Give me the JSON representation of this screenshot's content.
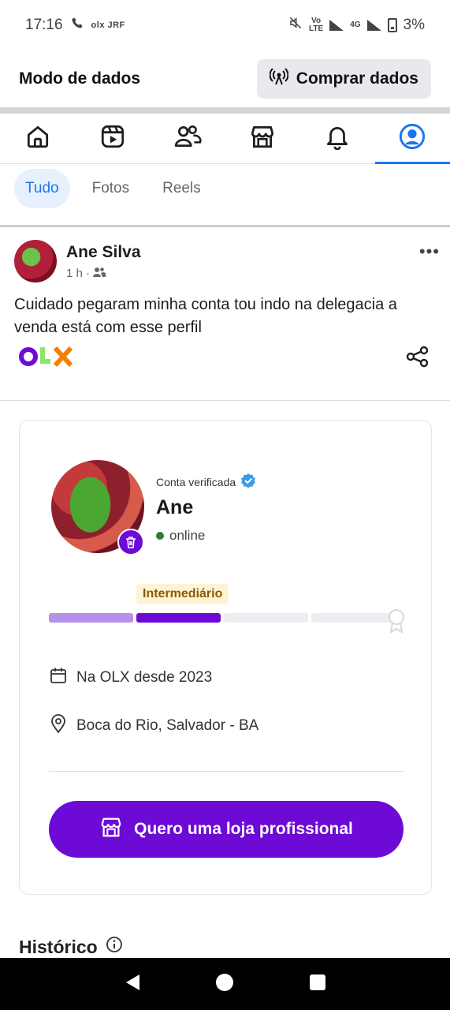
{
  "status_bar": {
    "time": "17:16",
    "carrier_icons_text": "olx JRF",
    "network_volte": "Vo",
    "network_lte": "LTE",
    "network_4g": "4G",
    "battery": "3%"
  },
  "data_bar": {
    "title": "Modo de dados",
    "buy_button": "Comprar dados"
  },
  "nav": {
    "items": [
      {
        "name": "home",
        "icon": "home-icon"
      },
      {
        "name": "video",
        "icon": "video-icon"
      },
      {
        "name": "friends",
        "icon": "friends-icon"
      },
      {
        "name": "marketplace",
        "icon": "store-icon"
      },
      {
        "name": "notifications",
        "icon": "bell-icon"
      },
      {
        "name": "profile",
        "icon": "profile-icon",
        "active": true
      }
    ]
  },
  "filter_tabs": [
    {
      "label": "Tudo",
      "active": true
    },
    {
      "label": "Fotos"
    },
    {
      "label": "Reels"
    }
  ],
  "post": {
    "author": "Ane Silva",
    "time": "1 h ·",
    "text": "Cuidado pegaram minha conta  tou indo na delegacia a venda está com esse perfil",
    "brand_logo": "OLX"
  },
  "profile_card": {
    "verified_label": "Conta verificada",
    "name": "Ane",
    "status": "online",
    "level": "Intermediário",
    "level_progress_segments_filled": 2,
    "level_progress_segments_total": 4,
    "member_since": "Na OLX desde 2023",
    "location": "Boca do Rio, Salvador - BA",
    "store_button": "Quero uma loja profissional"
  },
  "section": {
    "history_title": "Histórico"
  },
  "colors": {
    "facebook_blue": "#1877f2",
    "olx_purple": "#6e0ad6",
    "olx_green": "#8ce563",
    "olx_orange": "#f28000"
  }
}
